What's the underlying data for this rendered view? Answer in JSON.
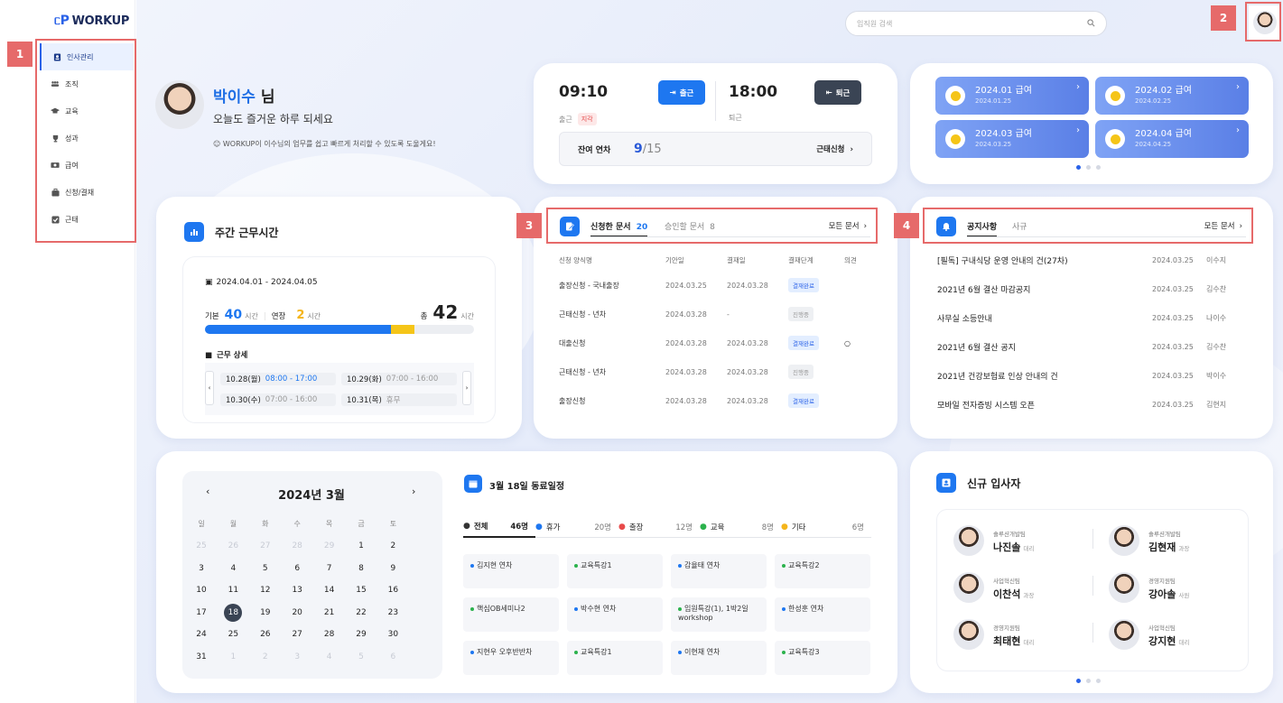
{
  "brand": {
    "name": "WORKUP"
  },
  "sidebar": {
    "items": [
      {
        "label": "인사관리",
        "icon": "person-card-icon",
        "active": true
      },
      {
        "label": "조직",
        "icon": "people-icon"
      },
      {
        "label": "교육",
        "icon": "graduation-cap-icon"
      },
      {
        "label": "성과",
        "icon": "trophy-icon"
      },
      {
        "label": "급여",
        "icon": "money-icon"
      },
      {
        "label": "신청/결재",
        "icon": "briefcase-icon"
      },
      {
        "label": "근태",
        "icon": "check-square-icon"
      }
    ]
  },
  "annotations": {
    "n1": "1",
    "n2": "2",
    "n3": "3",
    "n4": "4"
  },
  "header": {
    "search_placeholder": "임직원 검색"
  },
  "greeting": {
    "name": "박이수",
    "suffix": " 님",
    "subtitle": "오늘도 즐거운 하루 되세요",
    "note": "WORKUP이 이수님의 업무를 쉽고 빠르게 처리할 수 있도록 도울게요!"
  },
  "attendance": {
    "in_time": "09:10",
    "in_button": "출근",
    "in_label": "출근",
    "late_badge": "지각",
    "out_time": "18:00",
    "out_button": "퇴근",
    "out_label": "퇴근",
    "leave_label": "잔여 연차",
    "leave_used": "9",
    "leave_total": "/15",
    "leave_apply": "근태신청"
  },
  "payslips": [
    {
      "title": "2024.01 급여",
      "date": "2024.01.25"
    },
    {
      "title": "2024.02 급여",
      "date": "2024.02.25"
    },
    {
      "title": "2024.03 급여",
      "date": "2024.03.25"
    },
    {
      "title": "2024.04 급여",
      "date": "2024.04.25"
    }
  ],
  "weekly": {
    "title": "주간 근무시간",
    "range": "2024.04.01 - 2024.04.05",
    "basic_label": "기본",
    "basic_value": "40",
    "unit": "시간",
    "ext_label": "연장",
    "ext_value": "2",
    "total_label": "총",
    "total_value": "42",
    "basic_progress": 0.69,
    "ext_progress": 0.09,
    "detail_title": "근무 상세",
    "days": [
      {
        "day": "10.28(월)",
        "time": "08:00 - 17:00"
      },
      {
        "day": "10.29(화)",
        "time": "07:00 - 16:00"
      },
      {
        "day": "10.30(수)",
        "time": "07:00 - 16:00"
      },
      {
        "day": "10.31(목)",
        "time": "휴무"
      }
    ]
  },
  "approvals": {
    "tab1_label": "신청한 문서",
    "tab1_count": "20",
    "tab2_label": "승인할 문서",
    "tab2_count": "8",
    "all_docs": "모든 문서",
    "headers": [
      "신청 양식명",
      "기안일",
      "결재일",
      "결재단계",
      "의견"
    ],
    "rows": [
      {
        "form": "출장신청 - 국내출장",
        "draft": "2024.03.25",
        "approve": "2024.03.28",
        "status": "결재완료",
        "done": true,
        "comment": ""
      },
      {
        "form": "근태신청 - 년차",
        "draft": "2024.03.28",
        "approve": "-",
        "status": "진행중",
        "done": false,
        "comment": ""
      },
      {
        "form": "대출신청",
        "draft": "2024.03.28",
        "approve": "2024.03.28",
        "status": "결재완료",
        "done": true,
        "comment": "○"
      },
      {
        "form": "근태신청 - 년차",
        "draft": "2024.03.28",
        "approve": "2024.03.28",
        "status": "진행중",
        "done": false,
        "comment": ""
      },
      {
        "form": "출장신청",
        "draft": "2024.03.28",
        "approve": "2024.03.28",
        "status": "결재완료",
        "done": true,
        "comment": ""
      }
    ]
  },
  "notices": {
    "tab1": "공지사항",
    "tab2": "사규",
    "all_docs": "모든 문서",
    "rows": [
      {
        "title": "[필독] 구내식당 운영 안내의 건(27차)",
        "date": "2024.03.25",
        "author": "이수지"
      },
      {
        "title": "2021년 6월 결산 마감공지",
        "date": "2024.03.25",
        "author": "김수찬"
      },
      {
        "title": "사무실 소등안내",
        "date": "2024.03.25",
        "author": "나이수"
      },
      {
        "title": "2021년 6월 결산 공지",
        "date": "2024.03.25",
        "author": "김수찬"
      },
      {
        "title": "2021년 건강보험료 인상 안내의 건",
        "date": "2024.03.25",
        "author": "박이수"
      },
      {
        "title": "모바일 전자증빙 시스템 오픈",
        "date": "2024.03.25",
        "author": "김현지"
      }
    ]
  },
  "calendar": {
    "title": "2024년 3월",
    "weekdays": [
      "일",
      "월",
      "화",
      "수",
      "목",
      "금",
      "토"
    ],
    "weeks": [
      [
        "25",
        "26",
        "27",
        "28",
        "29",
        "1",
        "2"
      ],
      [
        "3",
        "4",
        "5",
        "6",
        "7",
        "8",
        "9"
      ],
      [
        "10",
        "11",
        "12",
        "13",
        "14",
        "15",
        "16"
      ],
      [
        "17",
        "18",
        "19",
        "20",
        "21",
        "22",
        "23"
      ],
      [
        "24",
        "25",
        "26",
        "27",
        "28",
        "29",
        "30"
      ],
      [
        "31",
        "1",
        "2",
        "3",
        "4",
        "5",
        "6"
      ]
    ]
  },
  "schedule": {
    "title": "3월 18일 동료일정",
    "filters": [
      {
        "label": "전체",
        "count": "46명",
        "icon": "people-icon",
        "color": "#333333"
      },
      {
        "label": "휴가",
        "count": "20명",
        "icon": "beach-umbrella-icon",
        "color": "#1e77f0"
      },
      {
        "label": "출장",
        "count": "12명",
        "icon": "suitcase-icon",
        "color": "#e84a4a"
      },
      {
        "label": "교육",
        "count": "8명",
        "icon": "graduation-cap-icon",
        "color": "#2bb24c"
      },
      {
        "label": "기타",
        "count": "6명",
        "icon": "grid-icon",
        "color": "#f5b51b"
      }
    ],
    "events": [
      {
        "text": "김지현 연차",
        "color": "#1e77f0"
      },
      {
        "text": "교육특강1",
        "color": "#2bb24c"
      },
      {
        "text": "감율태 연차",
        "color": "#1e77f0"
      },
      {
        "text": "교육특강2",
        "color": "#2bb24c"
      },
      {
        "text": "핵심OB세미나2",
        "color": "#2bb24c"
      },
      {
        "text": "박수현 연차",
        "color": "#1e77f0"
      },
      {
        "text": "임원특강(1), 1박2일 workshop",
        "color": "#2bb24c"
      },
      {
        "text": "한성훈 연차",
        "color": "#1e77f0"
      },
      {
        "text": "지현우 오후반반차",
        "color": "#1e77f0"
      },
      {
        "text": "교육특강1",
        "color": "#2bb24c"
      },
      {
        "text": "이현채 연차",
        "color": "#1e77f0"
      },
      {
        "text": "교육특강3",
        "color": "#2bb24c"
      }
    ]
  },
  "newhires": {
    "title": "신규 입사자",
    "people": [
      {
        "dept": "솔루션개발팀",
        "name": "나진솔",
        "rank": "대리"
      },
      {
        "dept": "솔루션개발팀",
        "name": "김현재",
        "rank": "과장"
      },
      {
        "dept": "사업혁신팀",
        "name": "이찬석",
        "rank": "과장"
      },
      {
        "dept": "경영지원팀",
        "name": "강아솔",
        "rank": "사원"
      },
      {
        "dept": "경영지원팀",
        "name": "최태현",
        "rank": "대리"
      },
      {
        "dept": "사업혁신팀",
        "name": "강지현",
        "rank": "대리"
      }
    ]
  }
}
